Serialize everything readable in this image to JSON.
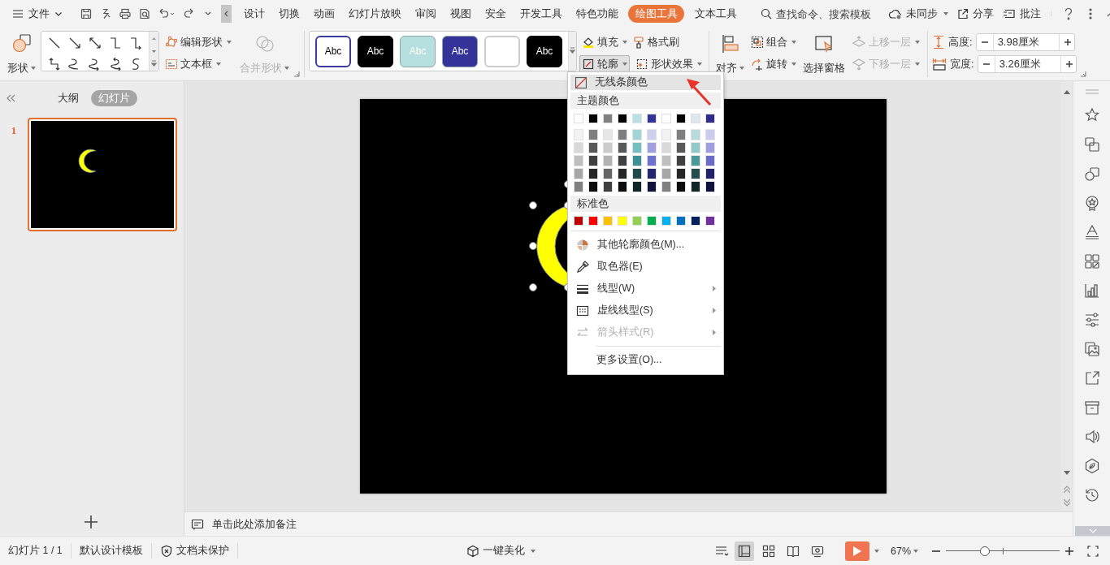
{
  "menu_bar": {
    "file_menu": "文件",
    "tabs": [
      {
        "label": "设计",
        "selected": false
      },
      {
        "label": "切换",
        "selected": false
      },
      {
        "label": "动画",
        "selected": false
      },
      {
        "label": "幻灯片放映",
        "selected": false
      },
      {
        "label": "审阅",
        "selected": false
      },
      {
        "label": "视图",
        "selected": false
      },
      {
        "label": "安全",
        "selected": false
      },
      {
        "label": "开发工具",
        "selected": false
      },
      {
        "label": "特色功能",
        "selected": false
      },
      {
        "label": "绘图工具",
        "selected": true
      },
      {
        "label": "文本工具",
        "selected": false
      }
    ],
    "search": {
      "placeholder": "查找命令、搜索模板"
    },
    "sync": "未同步",
    "share": "分享",
    "comment": "批注"
  },
  "ribbon": {
    "shapes": "形状",
    "edit_shape": "编辑形状",
    "text_box": "文本框",
    "merge_shapes": {
      "label": "合并形状",
      "disabled": true
    },
    "styles": [
      {
        "label": "Abc",
        "kind": "outline",
        "color": "#3c3c9c"
      },
      {
        "label": "Abc",
        "kind": "filled",
        "color": "#000000"
      },
      {
        "label": "Abc",
        "kind": "filled",
        "color": "#b7dfe0"
      },
      {
        "label": "Abc",
        "kind": "filled",
        "color": "#33339a"
      },
      {
        "kind": "blank",
        "color": "#ffffff"
      },
      {
        "label": "Abc",
        "kind": "filled",
        "color": "#000000"
      }
    ],
    "fill": "填充",
    "format_painter": "格式刷",
    "outline": {
      "label": "轮廓",
      "expanded": true
    },
    "shape_effects": "形状效果",
    "align": "对齐",
    "group": "组合",
    "rotate": "旋转",
    "selection_pane": "选择窗格",
    "bring_forward": {
      "label": "上移一层",
      "disabled": true
    },
    "send_backward": {
      "label": "下移一层",
      "disabled": true
    },
    "height": {
      "label": "高度:",
      "value": "3.98厘米"
    },
    "width": {
      "label": "宽度:",
      "value": "3.26厘米"
    }
  },
  "left_panel": {
    "tabs": [
      {
        "label": "大纲",
        "selected": false
      },
      {
        "label": "幻灯片",
        "selected": true
      }
    ],
    "slides": [
      {
        "number": "1",
        "selected": true
      }
    ]
  },
  "notes": {
    "placeholder": "单击此处添加备注"
  },
  "outline_menu": {
    "no_line": {
      "label": "无线条颜色",
      "highlighted": true
    },
    "theme_heading": "主题颜色",
    "theme_colors": [
      {
        "color": "#ffffff"
      },
      {
        "color": "#000000"
      },
      {
        "color": "#808080"
      },
      {
        "color": "#000000"
      },
      {
        "color": "#b9e0e2"
      },
      {
        "color": "#33339a"
      },
      {
        "color": "#ffffff"
      },
      {
        "color": "#000000"
      },
      {
        "color": "#dbe9ec"
      },
      {
        "color": "#2e2e8a"
      }
    ],
    "theme_shades": [
      {
        "swatches": [
          {
            "color": "#f2f2f2"
          },
          {
            "color": "#7f7f7f"
          },
          {
            "color": "#e6e6e6"
          },
          {
            "color": "#7f7f7f"
          },
          {
            "color": "#a2d5d7"
          },
          {
            "color": "#cfcff0"
          },
          {
            "color": "#f2f2f2"
          },
          {
            "color": "#7f7f7f"
          },
          {
            "color": "#b8dcdc"
          },
          {
            "color": "#ccccf0"
          }
        ]
      },
      {
        "swatches": [
          {
            "color": "#d9d9d9"
          },
          {
            "color": "#595959"
          },
          {
            "color": "#cccccc"
          },
          {
            "color": "#595959"
          },
          {
            "color": "#74c0c3"
          },
          {
            "color": "#a0a0e0"
          },
          {
            "color": "#d9d9d9"
          },
          {
            "color": "#595959"
          },
          {
            "color": "#8fc9c9"
          },
          {
            "color": "#9e9ee0"
          }
        ]
      },
      {
        "swatches": [
          {
            "color": "#bfbfbf"
          },
          {
            "color": "#404040"
          },
          {
            "color": "#b3b3b3"
          },
          {
            "color": "#404040"
          },
          {
            "color": "#3d9194"
          },
          {
            "color": "#7070d0"
          },
          {
            "color": "#bfbfbf"
          },
          {
            "color": "#404040"
          },
          {
            "color": "#4a9a9a"
          },
          {
            "color": "#6b6bcc"
          }
        ]
      },
      {
        "swatches": [
          {
            "color": "#a6a6a6"
          },
          {
            "color": "#262626"
          },
          {
            "color": "#666666"
          },
          {
            "color": "#262626"
          },
          {
            "color": "#1f4a4b"
          },
          {
            "color": "#262670"
          },
          {
            "color": "#a6a6a6"
          },
          {
            "color": "#262626"
          },
          {
            "color": "#244c4c"
          },
          {
            "color": "#22226a"
          }
        ]
      },
      {
        "swatches": [
          {
            "color": "#808080"
          },
          {
            "color": "#0d0d0d"
          },
          {
            "color": "#404040"
          },
          {
            "color": "#0d0d0d"
          },
          {
            "color": "#0f2526"
          },
          {
            "color": "#13133a"
          },
          {
            "color": "#808080"
          },
          {
            "color": "#0d0d0d"
          },
          {
            "color": "#122626"
          },
          {
            "color": "#111140"
          }
        ]
      }
    ],
    "standard_heading": "标准色",
    "standard_colors": [
      {
        "color": "#c00000"
      },
      {
        "color": "#ff0000"
      },
      {
        "color": "#ffc000"
      },
      {
        "color": "#ffff00"
      },
      {
        "color": "#92d050"
      },
      {
        "color": "#00b050"
      },
      {
        "color": "#00b0f0"
      },
      {
        "color": "#0070c0"
      },
      {
        "color": "#002060"
      },
      {
        "color": "#7030a0"
      }
    ],
    "items": [
      {
        "label": "其他轮廓颜色(M)...",
        "submenu": false,
        "disabled": false
      },
      {
        "label": "取色器(E)",
        "submenu": false,
        "disabled": false
      },
      {
        "label": "线型(W)",
        "submenu": true,
        "disabled": false
      },
      {
        "label": "虚线线型(S)",
        "submenu": true,
        "disabled": false
      },
      {
        "label": "箭头样式(R)",
        "submenu": true,
        "disabled": true
      }
    ],
    "more_settings": "更多设置(O)..."
  },
  "status_bar": {
    "slide_info": "幻灯片 1 / 1",
    "template": "默认设计模板",
    "protection": "文档未保护",
    "beautify": "一键美化",
    "views": [
      {
        "selected": true
      },
      {
        "selected": false
      },
      {
        "selected": false
      },
      {
        "selected": false
      }
    ],
    "zoom": "67%",
    "zoom_slider": {
      "level": 0.34
    }
  }
}
